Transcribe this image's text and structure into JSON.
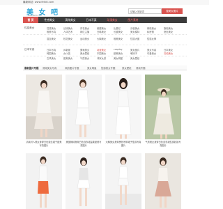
{
  "site": {
    "notice": "最新网址: www.feitdi.com",
    "logo_text": "美 女 吧",
    "logo_url": "www.feitdi.com"
  },
  "search": {
    "value": "请输入关键词",
    "button_label": "搜美女图片"
  },
  "nav": {
    "items": [
      {
        "label": "首 页",
        "home": true,
        "hl": false
      },
      {
        "label": "性感美女",
        "home": false,
        "hl": false
      },
      {
        "label": "清纯美女",
        "home": false,
        "hl": false
      },
      {
        "label": "日本写真",
        "home": false,
        "hl": false
      },
      {
        "label": "动漫美女",
        "home": false,
        "hl": true
      },
      {
        "label": "图片素材",
        "home": false,
        "hl": true
      }
    ]
  },
  "categories": {
    "rows": [
      {
        "label": "性感美女",
        "links": [
          "性感美女",
          "丝袜美女",
          "内衣美女",
          "美腿美女",
          "比基尼",
          "泳装美女",
          "网络美女",
          "旗袍美女",
          "唯美写真",
          "人体艺术",
          "网红主播",
          "日韩美女",
          "长腿美女",
          "美女模特",
          "私房照",
          "绝色美女",
          "混血美女",
          "校花美女",
          "运动美女",
          "大胸美女",
          "唯美美女",
          "性感大图",
          "性感女神"
        ]
      },
      {
        "label": "日本写真",
        "links": [
          "日本写真",
          "JK制服",
          "萝莉美女",
          "动漫美女",
          "cosplay",
          "美女图片",
          "美女写真",
          "日本美女",
          "韩国美女",
          "女仆装",
          "美女壁纸",
          "中国美女",
          "欧美美女",
          "萌妹子",
          "可爱美女",
          "清纯美女",
          "古风美女",
          "甜美美女",
          "气质美女",
          "邻家女孩",
          "美女明星",
          "美女壁纸"
        ]
      }
    ]
  },
  "tabs": {
    "items": [
      "最新图片专题",
      "清纯美女写真",
      "风韵图片专题",
      "美女明星",
      "性感美女专题",
      "美女壁纸",
      "清纯专题"
    ]
  },
  "cards": [
    {
      "caption": "清纯可人美女身穿白色蕾丝裙子甜美写真图片"
    },
    {
      "caption": "美国辣妹身穿白色连衣裙温柔甜美写真图片"
    },
    {
      "caption": "大胸美女身穿黑色吊带裙子性感写真图片"
    },
    {
      "caption": "气质美女身穿白色连衣裙性感妖娆写真图片"
    },
    {
      "caption": ""
    },
    {
      "caption": ""
    },
    {
      "caption": ""
    },
    {
      "caption": ""
    }
  ],
  "colors": {
    "accent": "#d9534f",
    "nav_bg": "#3b3b3b",
    "brand": "#2aa4d8"
  }
}
